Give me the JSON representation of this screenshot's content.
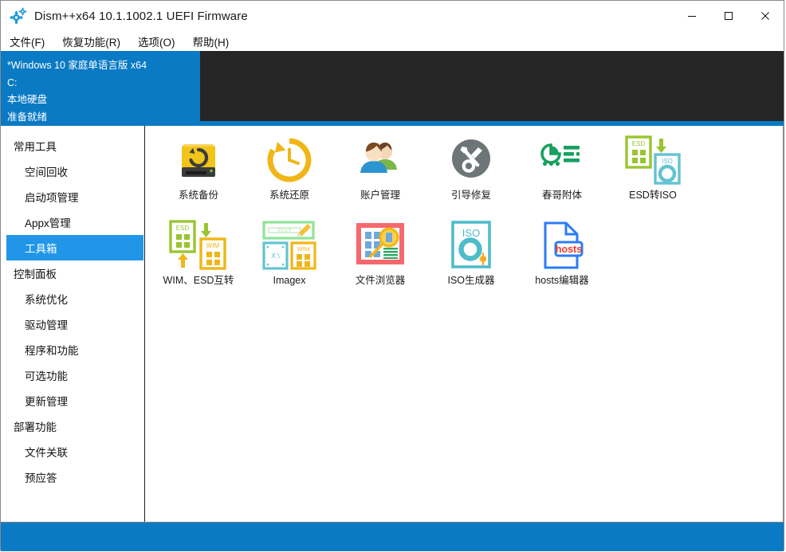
{
  "window": {
    "title": "Dism++x64 10.1.1002.1 UEFI Firmware",
    "app_icon": "gears-icon",
    "controls": {
      "minimize": "minimize-icon",
      "maximize": "maximize-icon",
      "close": "close-icon"
    }
  },
  "menubar": {
    "items": [
      {
        "label": "文件(F)"
      },
      {
        "label": "恢复功能(R)"
      },
      {
        "label": "选项(O)"
      },
      {
        "label": "帮助(H)"
      }
    ]
  },
  "info_panel": {
    "lines": [
      "*Windows 10 家庭单语言版 x64",
      "C:",
      "本地硬盘",
      "准备就绪"
    ]
  },
  "sidebar": {
    "sections": [
      {
        "title": "常用工具",
        "items": [
          {
            "label": "空间回收",
            "selected": false
          },
          {
            "label": "启动项管理",
            "selected": false
          },
          {
            "label": "Appx管理",
            "selected": false
          },
          {
            "label": "工具箱",
            "selected": true
          }
        ]
      },
      {
        "title": "控制面板",
        "items": [
          {
            "label": "系统优化",
            "selected": false
          },
          {
            "label": "驱动管理",
            "selected": false
          },
          {
            "label": "程序和功能",
            "selected": false
          },
          {
            "label": "可选功能",
            "selected": false
          },
          {
            "label": "更新管理",
            "selected": false
          }
        ]
      },
      {
        "title": "部署功能",
        "items": [
          {
            "label": "文件关联",
            "selected": false
          },
          {
            "label": "预应答",
            "selected": false
          }
        ]
      }
    ]
  },
  "toolbox": {
    "tiles": [
      {
        "label": "系统备份",
        "icon": "hard-drive-backup-icon"
      },
      {
        "label": "系统还原",
        "icon": "clock-restore-icon"
      },
      {
        "label": "账户管理",
        "icon": "users-icon"
      },
      {
        "label": "引导修复",
        "icon": "wrench-screwdriver-icon"
      },
      {
        "label": "春哥附体",
        "icon": "pie-chart-bars-icon"
      },
      {
        "label": "ESD转ISO",
        "icon": "esd-to-iso-icon"
      },
      {
        "label": "WIM、ESD互转",
        "icon": "wim-esd-swap-icon"
      },
      {
        "label": "Imagex",
        "icon": "imagex-edit-icon"
      },
      {
        "label": "文件浏览器",
        "icon": "file-browser-magnifier-icon"
      },
      {
        "label": "ISO生成器",
        "icon": "iso-builder-icon"
      },
      {
        "label": "hosts编辑器",
        "icon": "hosts-file-icon"
      }
    ]
  },
  "colors": {
    "accent_blue": "#0a7ac4",
    "selection_blue": "#2196e8",
    "dark_panel": "#262626"
  }
}
